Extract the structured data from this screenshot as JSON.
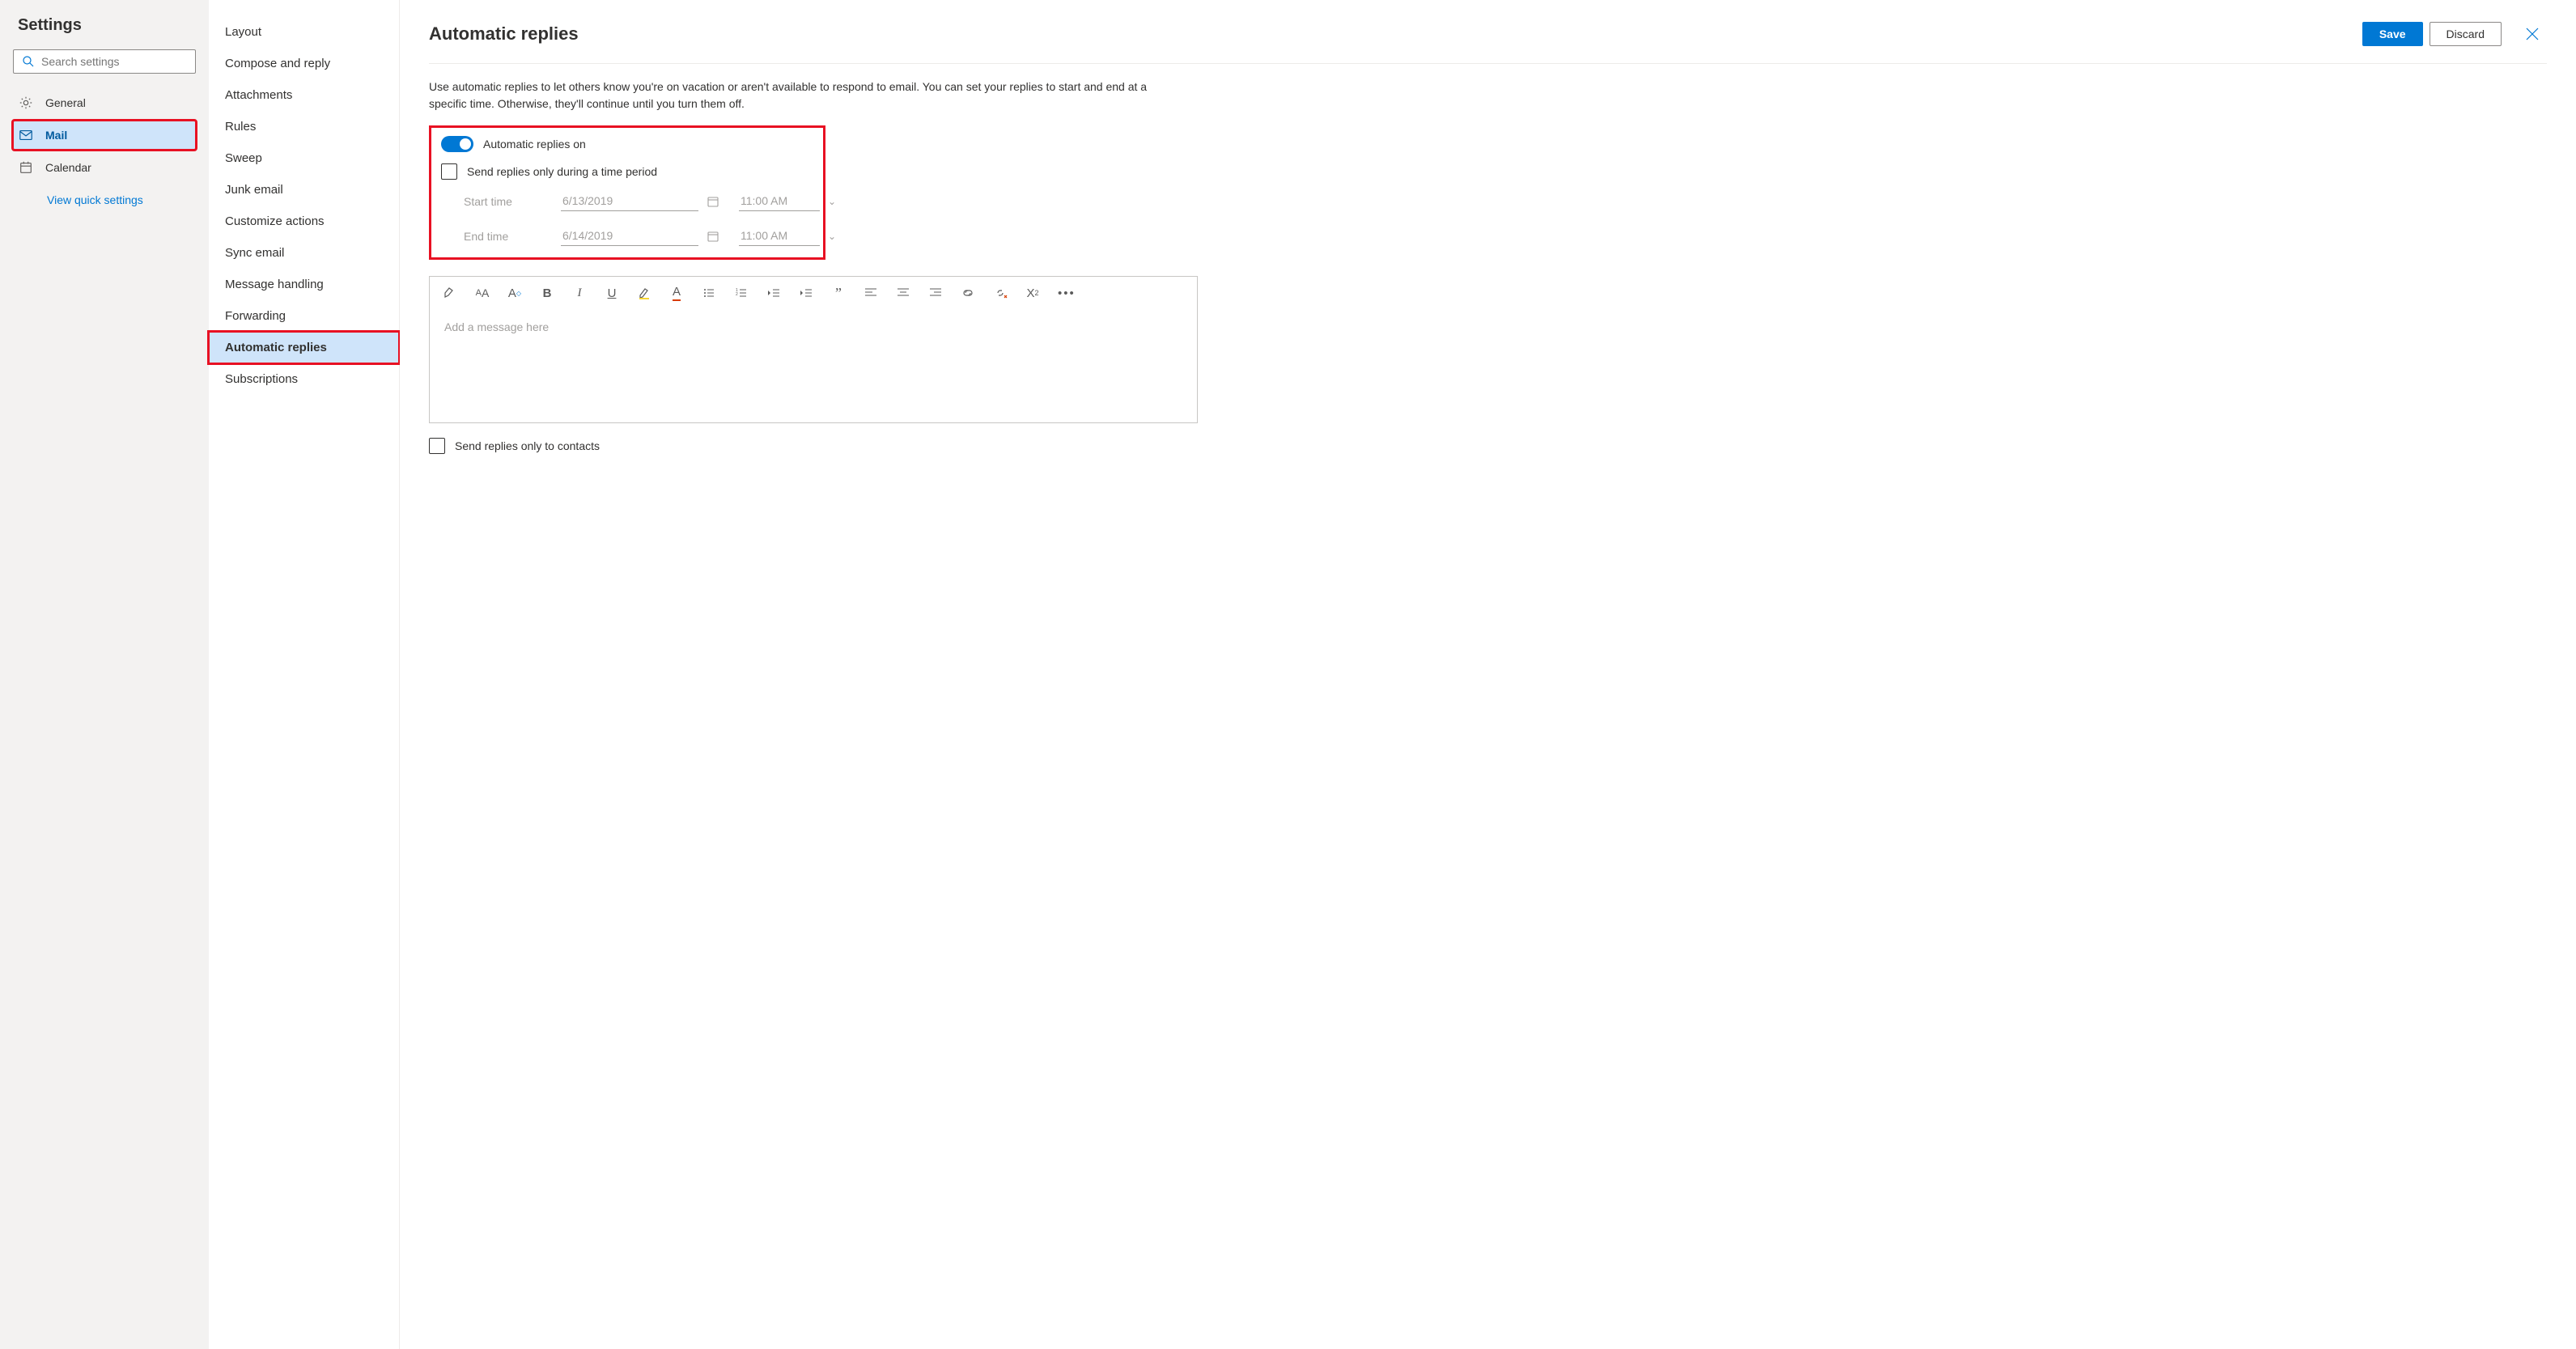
{
  "sidebarLeft": {
    "title": "Settings",
    "searchPlaceholder": "Search settings",
    "categories": [
      {
        "label": "General"
      },
      {
        "label": "Mail"
      },
      {
        "label": "Calendar"
      }
    ],
    "quickLink": "View quick settings"
  },
  "sidebarMid": {
    "items": [
      "Layout",
      "Compose and reply",
      "Attachments",
      "Rules",
      "Sweep",
      "Junk email",
      "Customize actions",
      "Sync email",
      "Message handling",
      "Forwarding",
      "Automatic replies",
      "Subscriptions"
    ]
  },
  "main": {
    "title": "Automatic replies",
    "saveLabel": "Save",
    "discardLabel": "Discard",
    "description": "Use automatic replies to let others know you're on vacation or aren't available to respond to email. You can set your replies to start and end at a specific time. Otherwise, they'll continue until you turn them off.",
    "toggleLabel": "Automatic replies on",
    "timePeriodLabel": "Send replies only during a time period",
    "startLabel": "Start time",
    "startDate": "6/13/2019",
    "startTime": "11:00 AM",
    "endLabel": "End time",
    "endDate": "6/14/2019",
    "endTime": "11:00 AM",
    "editorPlaceholder": "Add a message here",
    "contactsOnlyLabel": "Send replies only to contacts"
  }
}
